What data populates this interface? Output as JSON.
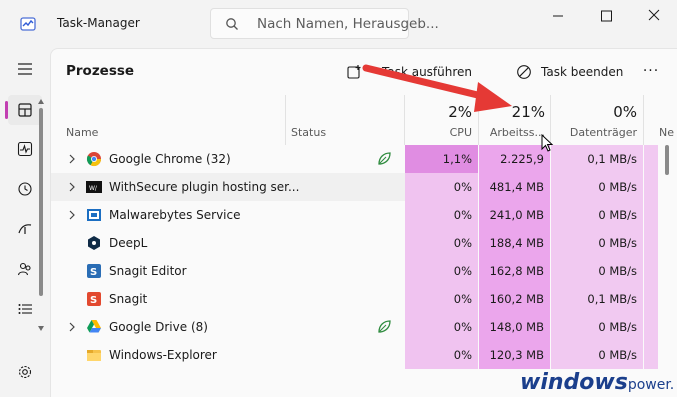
{
  "app": {
    "title": "Task-Manager"
  },
  "search": {
    "placeholder": "Nach Namen, Herausgeb..."
  },
  "window_buttons": [
    "minimize",
    "maximize",
    "close"
  ],
  "sidebar": {
    "items": [
      {
        "icon": "hamburger-icon"
      },
      {
        "icon": "processes-icon",
        "active": true
      },
      {
        "icon": "performance-icon"
      },
      {
        "icon": "app-history-icon"
      },
      {
        "icon": "startup-apps-icon"
      },
      {
        "icon": "users-icon"
      },
      {
        "icon": "details-icon"
      },
      {
        "icon": "services-icon"
      },
      {
        "icon": "settings-icon"
      }
    ]
  },
  "page": {
    "title": "Prozesse"
  },
  "toolbar": {
    "run_task_label": "Neuen Task ausführen",
    "run_task_visible": "Task ausführen",
    "end_task_label": "Task beenden",
    "more_label": "···"
  },
  "columns": {
    "name": "Name",
    "status": "Status",
    "cpu": {
      "pct": "2%",
      "label": "CPU"
    },
    "memory": {
      "pct": "21%",
      "label": "Arbeitss..."
    },
    "disk": {
      "pct": "0%",
      "label": "Datenträger"
    },
    "network": {
      "label": "Ne"
    }
  },
  "rows": [
    {
      "name": "Google Chrome (32)",
      "expandable": true,
      "eco": true,
      "cpu": "1,1%",
      "mem": "2.225,9 MB",
      "disk": "0,1 MB/s",
      "icon": "chrome-icon"
    },
    {
      "name": "WithSecure plugin hosting ser...",
      "expandable": true,
      "eco": false,
      "cpu": "0%",
      "mem": "481,4 MB",
      "disk": "0 MB/s",
      "icon": "withsecure-icon"
    },
    {
      "name": "Malwarebytes Service",
      "expandable": true,
      "eco": false,
      "cpu": "0%",
      "mem": "241,0 MB",
      "disk": "0 MB/s",
      "icon": "malwarebytes-icon"
    },
    {
      "name": "DeepL",
      "expandable": false,
      "eco": false,
      "cpu": "0%",
      "mem": "188,4 MB",
      "disk": "0 MB/s",
      "icon": "deepl-icon"
    },
    {
      "name": "Snagit Editor",
      "expandable": false,
      "eco": false,
      "cpu": "0%",
      "mem": "162,8 MB",
      "disk": "0 MB/s",
      "icon": "snagit-editor-icon"
    },
    {
      "name": "Snagit",
      "expandable": false,
      "eco": false,
      "cpu": "0%",
      "mem": "160,2 MB",
      "disk": "0,1 MB/s",
      "icon": "snagit-icon"
    },
    {
      "name": "Google Drive (8)",
      "expandable": true,
      "eco": true,
      "cpu": "0%",
      "mem": "148,0 MB",
      "disk": "0 MB/s",
      "icon": "google-drive-icon"
    },
    {
      "name": "Windows-Explorer",
      "expandable": false,
      "eco": false,
      "cpu": "0%",
      "mem": "120,3 MB",
      "disk": "0 MB/s",
      "icon": "explorer-icon"
    }
  ],
  "watermark": {
    "main": "windows",
    "suffix": "power."
  },
  "colors": {
    "accent": "#c23fb2",
    "cpu_cell": "#e79ae8",
    "mem_cell": "#e8a1e8",
    "disk_cell": "#f1c9f1",
    "arrow": "#e53935"
  }
}
